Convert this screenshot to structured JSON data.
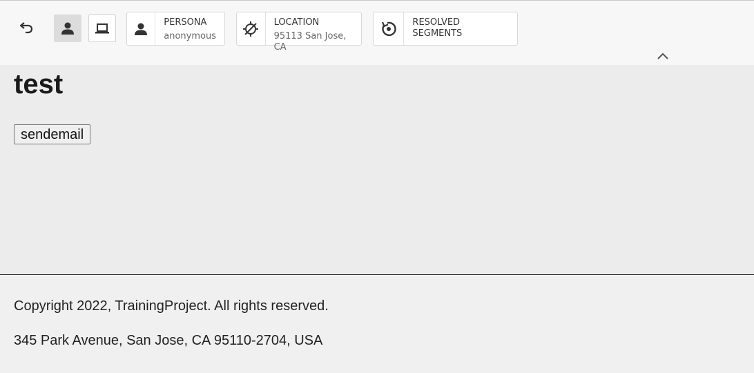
{
  "toolbar": {
    "icons": {
      "undo": "undo-icon",
      "person_mode": "person-icon",
      "device_mode": "laptop-icon",
      "collapse": "chevron-up-icon"
    },
    "persona": {
      "title": "PERSONA",
      "value": "anonymous",
      "icon": "person-icon"
    },
    "location": {
      "title": "LOCATION",
      "value": "95113 San Jose, CA",
      "icon": "location-off-icon"
    },
    "segments": {
      "title": "RESOLVED SEGMENTS",
      "value": "",
      "icon": "refresh-target-icon"
    }
  },
  "page": {
    "title": "test",
    "send_button_label": "sendemail"
  },
  "footer": {
    "copyright": "Copyright 2022, TrainingProject. All rights reserved.",
    "address": "345 Park Avenue, San Jose, CA 95110-2704, USA"
  },
  "colors": {
    "toolbar_bg": "#f7f7f7",
    "content_bg": "#ececec",
    "active_mode_bg": "#dcdcdc",
    "icon_color": "#333333"
  }
}
